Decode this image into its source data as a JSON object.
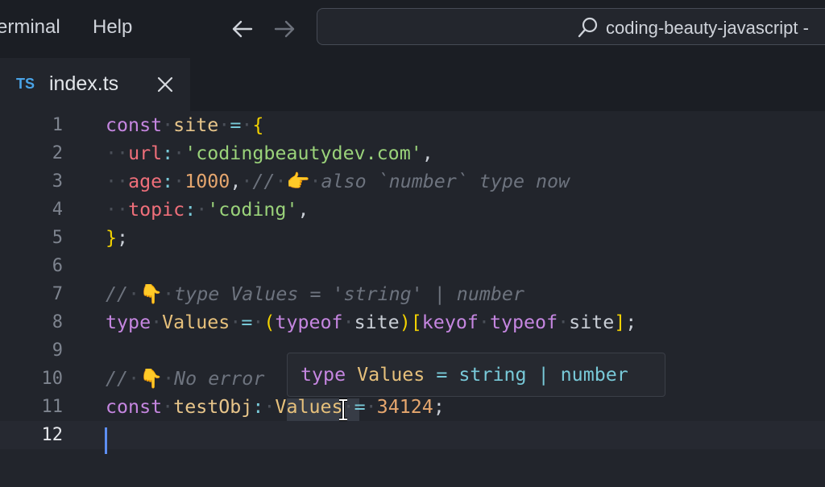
{
  "menu": {
    "terminal": "erminal",
    "help": "Help"
  },
  "search": {
    "text": "coding-beauty-javascript -"
  },
  "tab": {
    "lang_badge": "TS",
    "filename": "index.ts"
  },
  "line_numbers": [
    "1",
    "2",
    "3",
    "4",
    "5",
    "6",
    "7",
    "8",
    "9",
    "10",
    "11",
    "12"
  ],
  "code": {
    "l1": {
      "kw": "const",
      "name": "site",
      "eq": "=",
      "brace": "{"
    },
    "l2": {
      "key": "url",
      "colon": ":",
      "value": "'codingbeautydev.com'",
      "comma": ","
    },
    "l3": {
      "key": "age",
      "colon": ":",
      "value": "1000",
      "comma": ",",
      "comment_slashes": "//",
      "emoji": "👉",
      "comment": "also `number` type now"
    },
    "l4": {
      "key": "topic",
      "colon": ":",
      "value": "'coding'",
      "comma": ","
    },
    "l5": {
      "brace": "}",
      "semi": ";"
    },
    "l7": {
      "comment_slashes": "//",
      "emoji": "👇",
      "comment": "type Values = 'string' | number"
    },
    "l8": {
      "kw": "type",
      "name": "Values",
      "eq": "=",
      "open_paren": "(",
      "typeof1": "typeof",
      "site1": "site",
      "close_paren": ")",
      "open_br": "[",
      "keyof": "keyof",
      "typeof2": "typeof",
      "site2": "site",
      "close_br": "]",
      "semi": ";"
    },
    "l10": {
      "comment_slashes": "//",
      "emoji": "👇",
      "comment": "No error"
    },
    "l11": {
      "kw": "const",
      "name": "testObj",
      "colon": ":",
      "type": "Values",
      "eq": "=",
      "value": "34124",
      "semi": ";"
    }
  },
  "tooltip": {
    "kw": "type",
    "name": "Values",
    "eq": "=",
    "t1": "string",
    "pipe": "|",
    "t2": "number"
  }
}
